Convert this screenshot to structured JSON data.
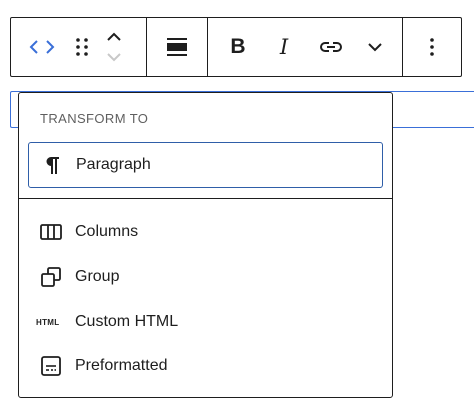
{
  "toolbar": {
    "transform_icon": "code-brackets-icon",
    "drag_icon": "drag-handle-icon",
    "move_icon": "chevron-up-down-icon",
    "align_icon": "align-icon",
    "bold_label": "B",
    "italic_label": "I",
    "link_icon": "link-icon",
    "more_rich_text_icon": "chevron-down-icon",
    "options_icon": "more-vertical-icon",
    "accent_color": "#3a6fd8"
  },
  "popover": {
    "heading": "TRANSFORM TO",
    "primary": [
      {
        "label": "Paragraph",
        "icon": "paragraph-icon",
        "active": true
      }
    ],
    "items": [
      {
        "label": "Columns",
        "icon": "columns-icon"
      },
      {
        "label": "Group",
        "icon": "group-icon"
      },
      {
        "label": "Custom HTML",
        "icon": "html-icon",
        "icon_text": "HTML"
      },
      {
        "label": "Preformatted",
        "icon": "preformatted-icon"
      }
    ]
  }
}
